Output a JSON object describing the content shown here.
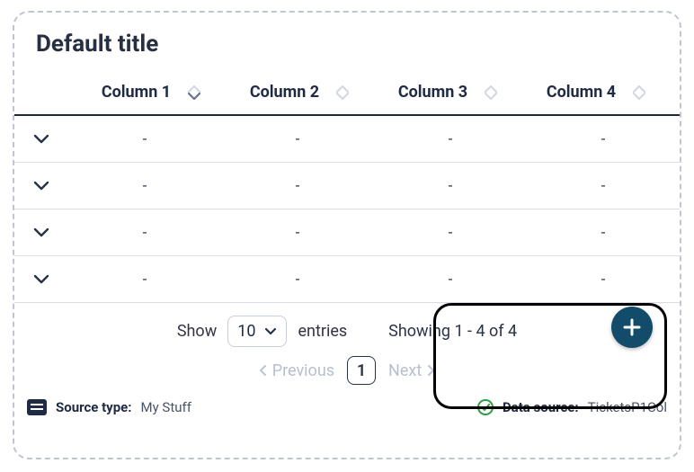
{
  "title": "Default title",
  "columns": [
    "Column 1",
    "Column 2",
    "Column 3",
    "Column 4"
  ],
  "table": {
    "rows": [
      {
        "c1": "-",
        "c2": "-",
        "c3": "-",
        "c4": "-"
      },
      {
        "c1": "-",
        "c2": "-",
        "c3": "-",
        "c4": "-"
      },
      {
        "c1": "-",
        "c2": "-",
        "c3": "-",
        "c4": "-"
      },
      {
        "c1": "-",
        "c2": "-",
        "c3": "-",
        "c4": "-"
      }
    ]
  },
  "footer": {
    "show_label": "Show",
    "entries_label": "entries",
    "page_size": "10",
    "showing_text": "Showing 1 - 4 of 4",
    "prev_label": "Previous",
    "next_label": "Next",
    "current_page": "1"
  },
  "status": {
    "source_type_label": "Source type:",
    "source_type_value": "My Stuff",
    "data_source_label": "Data source:",
    "data_source_value": "TicketsP1Col"
  },
  "colors": {
    "accent_fab": "#134b6b",
    "ok_green": "#2e9e46"
  }
}
